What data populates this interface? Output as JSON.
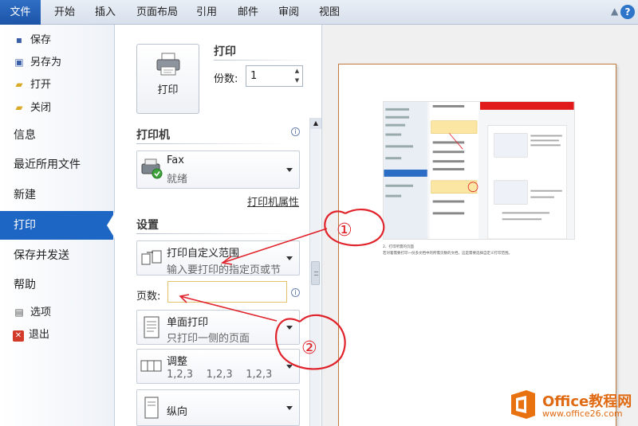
{
  "ribbon": {
    "tabs": [
      {
        "label": "文件"
      },
      {
        "label": "开始"
      },
      {
        "label": "插入"
      },
      {
        "label": "页面布局"
      },
      {
        "label": "引用"
      },
      {
        "label": "邮件"
      },
      {
        "label": "审阅"
      },
      {
        "label": "视图"
      }
    ],
    "help": "?"
  },
  "leftnav": {
    "save": "保存",
    "save_as": "另存为",
    "open": "打开",
    "close": "关闭",
    "info": "信息",
    "recent": "最近所用文件",
    "new": "新建",
    "print": "打印",
    "save_send": "保存并发送",
    "help": "帮助",
    "options": "选项",
    "exit": "退出"
  },
  "print": {
    "section_title": "打印",
    "button_label": "打印",
    "copies_label": "份数:",
    "copies_value": "1"
  },
  "printer": {
    "section_title": "打印机",
    "name": "Fax",
    "status": "就绪",
    "properties_link": "打印机属性"
  },
  "settings": {
    "section_title": "设置",
    "range_title": "打印自定义范围",
    "range_sub": "输入要打印的指定页或节",
    "pages_label": "页数:",
    "pages_value": "",
    "sides_title": "单面打印",
    "sides_sub": "只打印一侧的页面",
    "collate_title": "调整",
    "collate_sub": "1,2,3    1,2,3    1,2,3",
    "orientation_title": "纵向"
  },
  "preview": {
    "caption1": "2、打印所需的页面",
    "caption2": "若对着需要打印一份多文档中的所需页数的文档，这是需要选择自定义打印范围。"
  },
  "watermark": {
    "title": "Office教程网",
    "url": "www.office26.com"
  },
  "annotations": {
    "mark1": "①",
    "mark2": "②"
  },
  "colors": {
    "accent": "#1e66c4",
    "annotation": "#e0222a",
    "brand": "#e06a12"
  }
}
